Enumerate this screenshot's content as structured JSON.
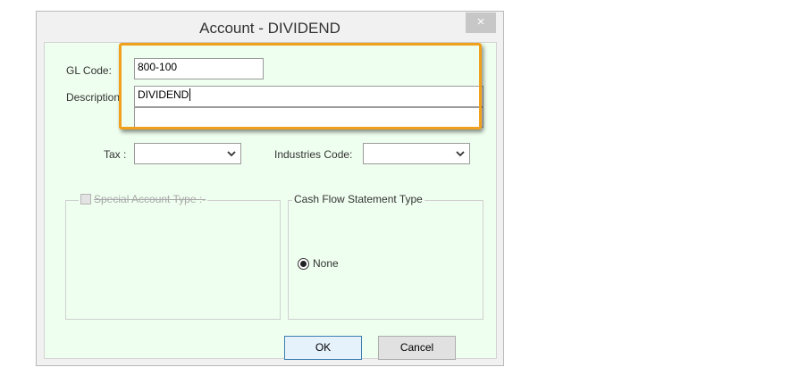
{
  "window": {
    "title": "Account - DIVIDEND",
    "close_glyph": "×"
  },
  "form": {
    "gl_code_label": "GL Code:",
    "gl_code_value": "800-100",
    "description_label": "Description:",
    "description_value": "DIVIDEND",
    "description2_value": "",
    "tax_label": "Tax :",
    "tax_value": "",
    "industries_label": "Industries Code:",
    "industries_value": ""
  },
  "special_account": {
    "label": "Special Account Type :-",
    "checked": false
  },
  "cash_flow": {
    "label": "Cash Flow Statement Type",
    "selected_option": "None"
  },
  "buttons": {
    "ok": "OK",
    "cancel": "Cancel"
  },
  "highlight": {
    "color": "#f0a01a"
  },
  "icons": {
    "dropdown": "chevron-down-icon"
  }
}
